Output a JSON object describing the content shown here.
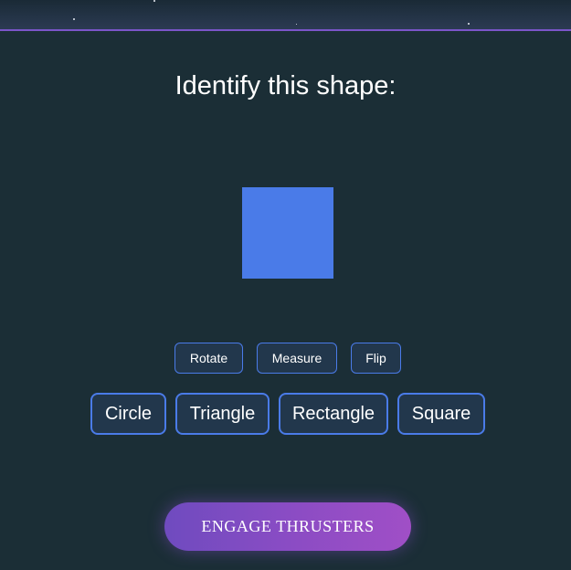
{
  "prompt": "Identify this shape:",
  "shape": {
    "kind": "square",
    "color": "#4a7be8"
  },
  "tools": [
    {
      "label": "Rotate"
    },
    {
      "label": "Measure"
    },
    {
      "label": "Flip"
    }
  ],
  "answers": [
    {
      "label": "Circle"
    },
    {
      "label": "Triangle"
    },
    {
      "label": "Rectangle"
    },
    {
      "label": "Square"
    }
  ],
  "action": {
    "label": "ENGAGE THRUSTERS"
  },
  "colors": {
    "background": "#1b2e36",
    "accent_border": "#4a7be8",
    "band_line": "#7b55c9",
    "engage_gradient_start": "#6f4bbf",
    "engage_gradient_end": "#a04fc6"
  }
}
